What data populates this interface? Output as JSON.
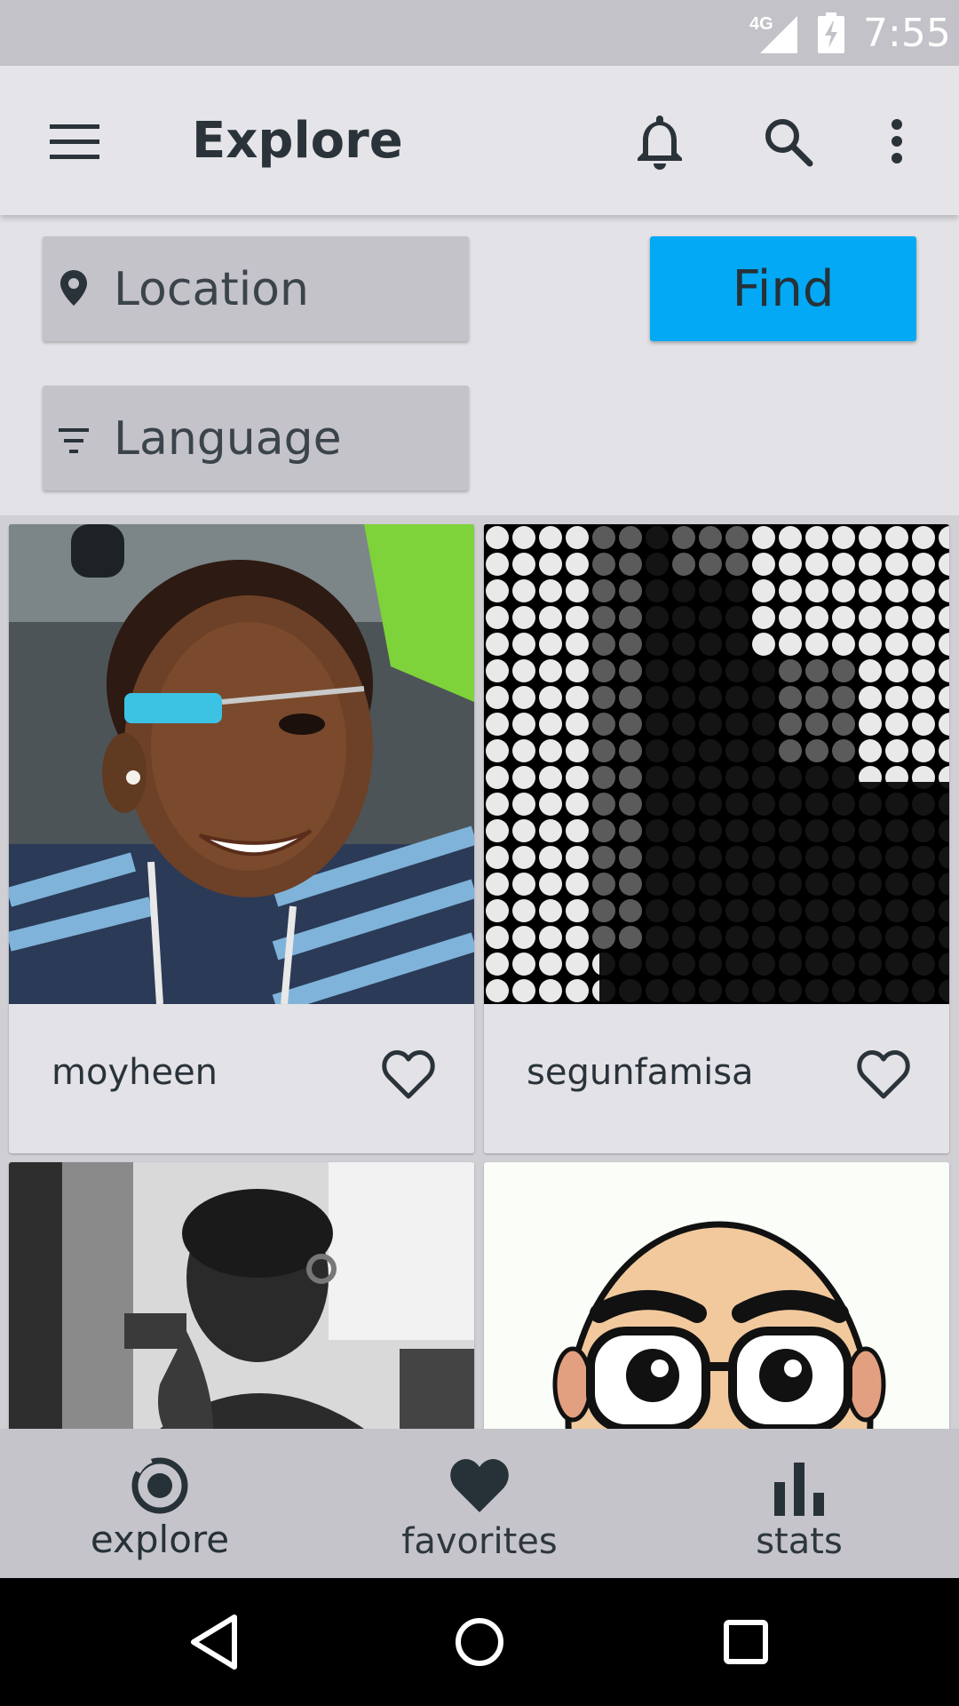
{
  "status_bar": {
    "network": "4G",
    "time": "7:55"
  },
  "app_bar": {
    "title": "Explore",
    "icons": [
      "menu-icon",
      "bell-icon",
      "search-icon",
      "more-vert-icon"
    ]
  },
  "filters": {
    "location_label": "Location",
    "language_label": "Language",
    "find_label": "Find"
  },
  "users": [
    {
      "username": "moyheen",
      "favorited": false
    },
    {
      "username": "segunfamisa",
      "favorited": false
    },
    {
      "username": "",
      "favorited": false
    },
    {
      "username": "",
      "favorited": false
    }
  ],
  "bottom_nav": {
    "items": [
      {
        "label": "explore",
        "icon": "explore-icon",
        "active": true
      },
      {
        "label": "favorites",
        "icon": "heart-icon",
        "active": false
      },
      {
        "label": "stats",
        "icon": "bar-chart-icon",
        "active": false
      }
    ]
  },
  "colors": {
    "accent": "#03a9f4",
    "app_bar": "#e5e4e8",
    "nav_bar": "#c5c4ca",
    "text_dark": "#263238"
  }
}
